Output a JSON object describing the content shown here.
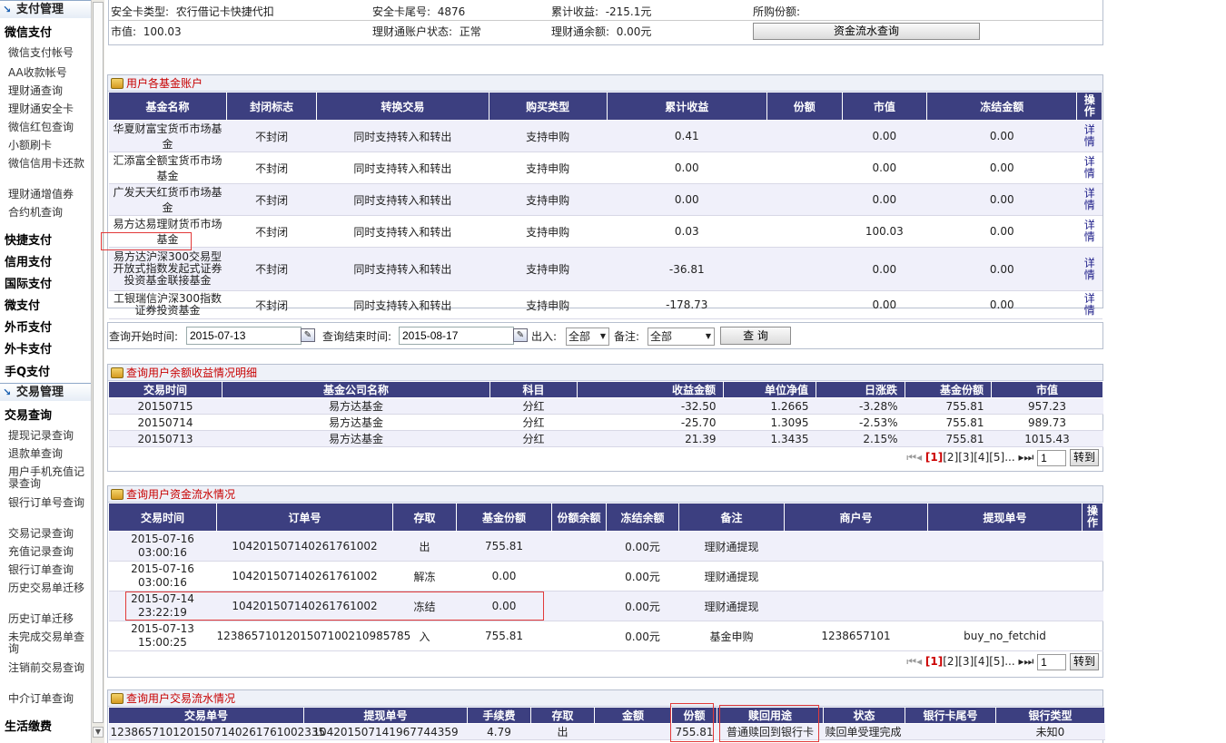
{
  "sidebar": {
    "pay_mgmt": "支付管理",
    "wechat": "微信支付",
    "wechat_items": [
      "微信支付帐号",
      "AA收款帐号",
      "理财通查询",
      "理财通安全卡",
      "微信红包查询",
      "小额刷卡",
      "微信信用卡还款",
      "理财通增值券",
      "合约机查询"
    ],
    "groups": [
      "快捷支付",
      "信用支付",
      "国际支付",
      "微支付",
      "外币支付",
      "外卡支付",
      "手Q支付"
    ],
    "trade_mgmt": "交易管理",
    "trade_query": "交易查询",
    "trade_items": [
      "提现记录查询",
      "退款单查询",
      "用户手机充值记录查询",
      "银行订单号查询",
      "交易记录查询",
      "充值记录查询",
      "银行订单查询",
      "历史交易单迁移",
      "历史订单迁移",
      "未完成交易单查询",
      "注销前交易查询",
      "中介订单查询"
    ],
    "life": "生活缴费"
  },
  "info": {
    "card_type_label": "安全卡类型:",
    "card_type": "农行借记卡快捷代扣",
    "card_tail_label": "安全卡尾号:",
    "card_tail": "4876",
    "cum_label": "累计收益:",
    "cum": "-215.1元",
    "shares_label": "所购份额:",
    "mv_label": "市值:",
    "mv": "100.03",
    "status_label": "理财通账户状态:",
    "status": "正常",
    "balance_label": "理财通余额:",
    "balance": "0.00元",
    "flow_button": "资金流水查询"
  },
  "funds": {
    "title": "用户各基金账户",
    "headers": [
      "基金名称",
      "封闭标志",
      "转换交易",
      "购买类型",
      "累计收益",
      "份额",
      "市值",
      "冻结金额",
      "操作"
    ],
    "rows": [
      [
        "华夏财富宝货币市场基金",
        "不封闭",
        "同时支持转入和转出",
        "支持申购",
        "0.41",
        "",
        "0.00",
        "0.00",
        "详情"
      ],
      [
        "汇添富全额宝货币市场基金",
        "不封闭",
        "同时支持转入和转出",
        "支持申购",
        "0.00",
        "",
        "0.00",
        "0.00",
        "详情"
      ],
      [
        "广发天天红货币市场基金",
        "不封闭",
        "同时支持转入和转出",
        "支持申购",
        "0.00",
        "",
        "0.00",
        "0.00",
        "详情"
      ],
      [
        "易方达易理财货币市场基金",
        "不封闭",
        "同时支持转入和转出",
        "支持申购",
        "0.03",
        "",
        "100.03",
        "0.00",
        "详情"
      ],
      [
        "易方达沪深300交易型开放式指数发起式证券投资基金联接基金",
        "不封闭",
        "同时支持转入和转出",
        "支持申购",
        "-36.81",
        "",
        "0.00",
        "0.00",
        "详情"
      ],
      [
        "工银瑞信沪深300指数证券投资基金",
        "不封闭",
        "同时支持转入和转出",
        "支持申购",
        "-178.73",
        "",
        "0.00",
        "0.00",
        "详情"
      ]
    ]
  },
  "query": {
    "start_label": "查询开始时间:",
    "start": "2015-07-13",
    "end_label": "查询结束时间:",
    "end": "2015-08-17",
    "io_label": "出入:",
    "io": "全部",
    "note_label": "备注:",
    "note": "全部",
    "button": "查 询"
  },
  "income": {
    "title": "查询用户余额收益情况明细",
    "headers": [
      "交易时间",
      "基金公司名称",
      "科目",
      "收益金额",
      "单位净值",
      "日涨跌",
      "基金份额",
      "市值"
    ],
    "rows": [
      [
        "20150715",
        "易方达基金",
        "分红",
        "-32.50",
        "1.2665",
        "-3.28%",
        "755.81",
        "957.23"
      ],
      [
        "20150714",
        "易方达基金",
        "分红",
        "-25.70",
        "1.3095",
        "-2.53%",
        "755.81",
        "989.73"
      ],
      [
        "20150713",
        "易方达基金",
        "分红",
        "21.39",
        "1.3435",
        "2.15%",
        "755.81",
        "1015.43"
      ]
    ]
  },
  "pager": {
    "current": "[1]",
    "pages": "[2][3][4][5]...",
    "page_input": "1",
    "go": "转到"
  },
  "flow": {
    "title": "查询用户资金流水情况",
    "headers": [
      "交易时间",
      "订单号",
      "存取",
      "基金份额",
      "份额余额",
      "冻结余额",
      "备注",
      "商户号",
      "提现单号",
      "操作"
    ],
    "rows": [
      [
        "2015-07-16 03:00:16",
        "104201507140261761002",
        "出",
        "755.81",
        "",
        "0.00元",
        "理财通提现",
        "",
        ""
      ],
      [
        "2015-07-16 03:00:16",
        "104201507140261761002",
        "解冻",
        "0.00",
        "",
        "0.00元",
        "理财通提现",
        "",
        ""
      ],
      [
        "2015-07-14 23:22:19",
        "104201507140261761002",
        "冻结",
        "0.00",
        "",
        "0.00元",
        "理财通提现",
        "",
        ""
      ],
      [
        "2015-07-13 15:00:25",
        "1238657101201507100210985785",
        "入",
        "755.81",
        "",
        "0.00元",
        "基金申购",
        "1238657101",
        "buy_no_fetchid"
      ]
    ]
  },
  "trade": {
    "title": "查询用户交易流水情况",
    "headers": [
      "交易单号",
      "提现单号",
      "手续费",
      "存取",
      "金额",
      "份额",
      "赎回用途",
      "状态",
      "银行卡尾号",
      "银行类型"
    ],
    "rows": [
      [
        "1238657101201507140261761002335",
        "104201507141967744359",
        "4.79",
        "出",
        "",
        "755.81",
        "普通赎回到银行卡",
        "赎回单受理完成",
        "",
        "未知0"
      ]
    ]
  }
}
